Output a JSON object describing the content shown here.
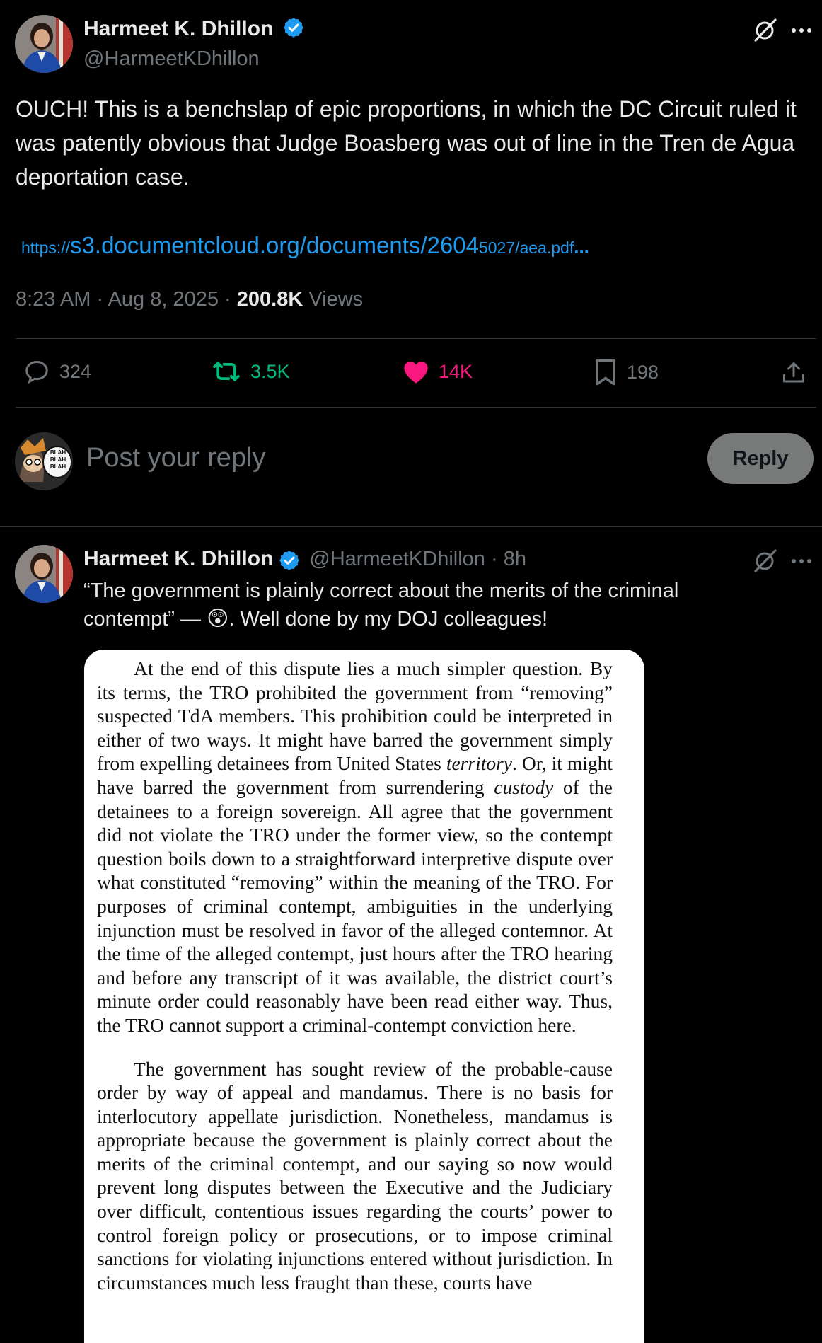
{
  "main_tweet": {
    "author_name": "Harmeet K. Dhillon",
    "author_handle": "@HarmeetKDhillon",
    "text": "OUCH! This is a benchslap of epic proportions, in which the DC Circuit ruled it was patently obvious that Judge Boasberg was out of line in the Tren de Agua deportation case.",
    "link": {
      "prefix": "https://",
      "main": "s3.documentcloud.org/documents/2604",
      "suffix": "5027/aea.pdf",
      "ellipsis": "..."
    },
    "time": "8:23 AM · Aug 8, 2025 · ",
    "views_count": "200.8K",
    "views_label": " Views",
    "stats": {
      "replies": "324",
      "reposts": "3.5K",
      "likes": "14K",
      "bookmarks": "198"
    }
  },
  "reply_box": {
    "placeholder": "Post your reply",
    "button_label": "Reply",
    "avatar_text": [
      "BLAH",
      "BLAH",
      "BLAH"
    ]
  },
  "reply_tweet": {
    "author_name": "Harmeet K. Dhillon",
    "author_handle": "@HarmeetKDhillon · 8h",
    "text_line1": "“The government is plainly correct about the merits of the criminal",
    "text_line2_a": "contempt” — ",
    "emoji": "😲",
    "text_line2_b": ".  Well done by my DOJ colleagues!",
    "document": {
      "para1_a": "At the end of this dispute lies a much simpler question. By its terms, the TRO prohibited the government from “removing” suspected TdA members. This prohibition could be interpreted in either of two ways. It might have barred the government simply from expelling detainees from United States ",
      "para1_territory": "territory",
      "para1_b": ". Or, it might have barred the government from surrendering ",
      "para1_custody": "custody",
      "para1_c": " of the detainees to a foreign sovereign. All agree that the government did not violate the TRO under the former view, so the contempt question boils down to a straightforward interpretive dispute over what constituted “removing” within the meaning of the TRO. For purposes of criminal contempt, ambiguities in the underlying injunction must be resolved in favor of the alleged contemnor. At the time of the alleged contempt, just hours after the TRO hearing and before any transcript of it was available, the district court’s minute order could reasonably have been read either way. Thus, the TRO cannot support a criminal-contempt conviction here.",
      "para2": "The government has sought review of the probable-cause order by way of appeal and mandamus. There is no basis for interlocutory appellate jurisdiction. Nonetheless, mandamus is appropriate because the government is plainly correct about the merits of the criminal contempt, and our saying so now would prevent long disputes between the Executive and the Judiciary over difficult, contentious issues regarding the courts’ power to control foreign policy or prosecutions, or to impose criminal sanctions for violating injunctions entered without jurisdiction. In circumstances much less fraught than these, courts have"
    }
  },
  "colors": {
    "background": "#000000",
    "accent_blue": "#1d9bf0",
    "repost_green": "#00ba7c",
    "like_pink": "#f91880",
    "muted": "#71767b"
  }
}
